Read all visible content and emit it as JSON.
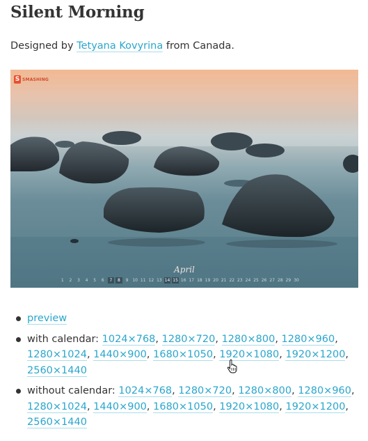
{
  "title": "Silent Morning",
  "byline": {
    "prefix": "Designed by",
    "designer": "Tetyana Kovyrina",
    "suffix": "from Canada."
  },
  "wallpaper": {
    "logo_text": "SMASHING",
    "logo_letter": "S",
    "month": "April",
    "days": [
      "1",
      "2",
      "3",
      "4",
      "5",
      "6",
      "7",
      "8",
      "9",
      "10",
      "11",
      "12",
      "13",
      "14",
      "15",
      "16",
      "17",
      "18",
      "19",
      "20",
      "21",
      "22",
      "23",
      "24",
      "25",
      "26",
      "27",
      "28",
      "29",
      "30"
    ]
  },
  "preview_label": "preview",
  "with_calendar": {
    "label": "with calendar:",
    "resolutions": [
      "1024×768",
      "1280×720",
      "1280×800",
      "1280×960",
      "1280×1024",
      "1440×900",
      "1680×1050",
      "1920×1080",
      "1920×1200",
      "2560×1440"
    ]
  },
  "without_calendar": {
    "label": "without calendar:",
    "resolutions": [
      "1024×768",
      "1280×720",
      "1280×800",
      "1280×960",
      "1280×1024",
      "1440×900",
      "1680×1050",
      "1920×1080",
      "1920×1200",
      "2560×1440"
    ]
  },
  "colors": {
    "link": "#2aa6cc",
    "text": "#333333",
    "brand": "#e8502f"
  }
}
